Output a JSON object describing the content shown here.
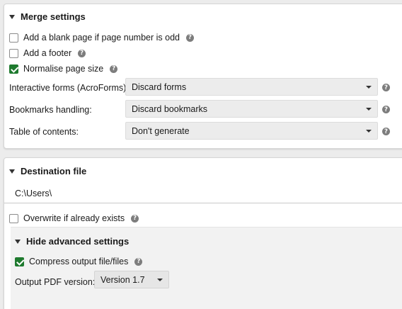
{
  "merge": {
    "title": "Merge settings",
    "blank_page": {
      "label": "Add a blank page if page number is odd",
      "checked": false
    },
    "footer": {
      "label": "Add a footer",
      "checked": false
    },
    "normalise": {
      "label": "Normalise page size",
      "checked": true
    },
    "forms": {
      "label": "Interactive forms (AcroForms):",
      "value": "Discard forms"
    },
    "bookmarks": {
      "label": "Bookmarks handling:",
      "value": "Discard bookmarks"
    },
    "toc": {
      "label": "Table of contents:",
      "value": "Don't generate"
    }
  },
  "destination": {
    "title": "Destination file",
    "path": "C:\\Users\\",
    "overwrite": {
      "label": "Overwrite if already exists",
      "checked": false
    },
    "advanced": {
      "toggle_label": "Hide advanced settings",
      "compress": {
        "label": "Compress output file/files",
        "checked": true
      },
      "version": {
        "label": "Output PDF version:",
        "value": "Version 1.7"
      }
    }
  },
  "icons": {
    "help": "?"
  },
  "colors": {
    "checkbox_checked": "#1e7a2e",
    "select_bg": "#ececec",
    "advanced_bg": "#f2f2f2"
  }
}
